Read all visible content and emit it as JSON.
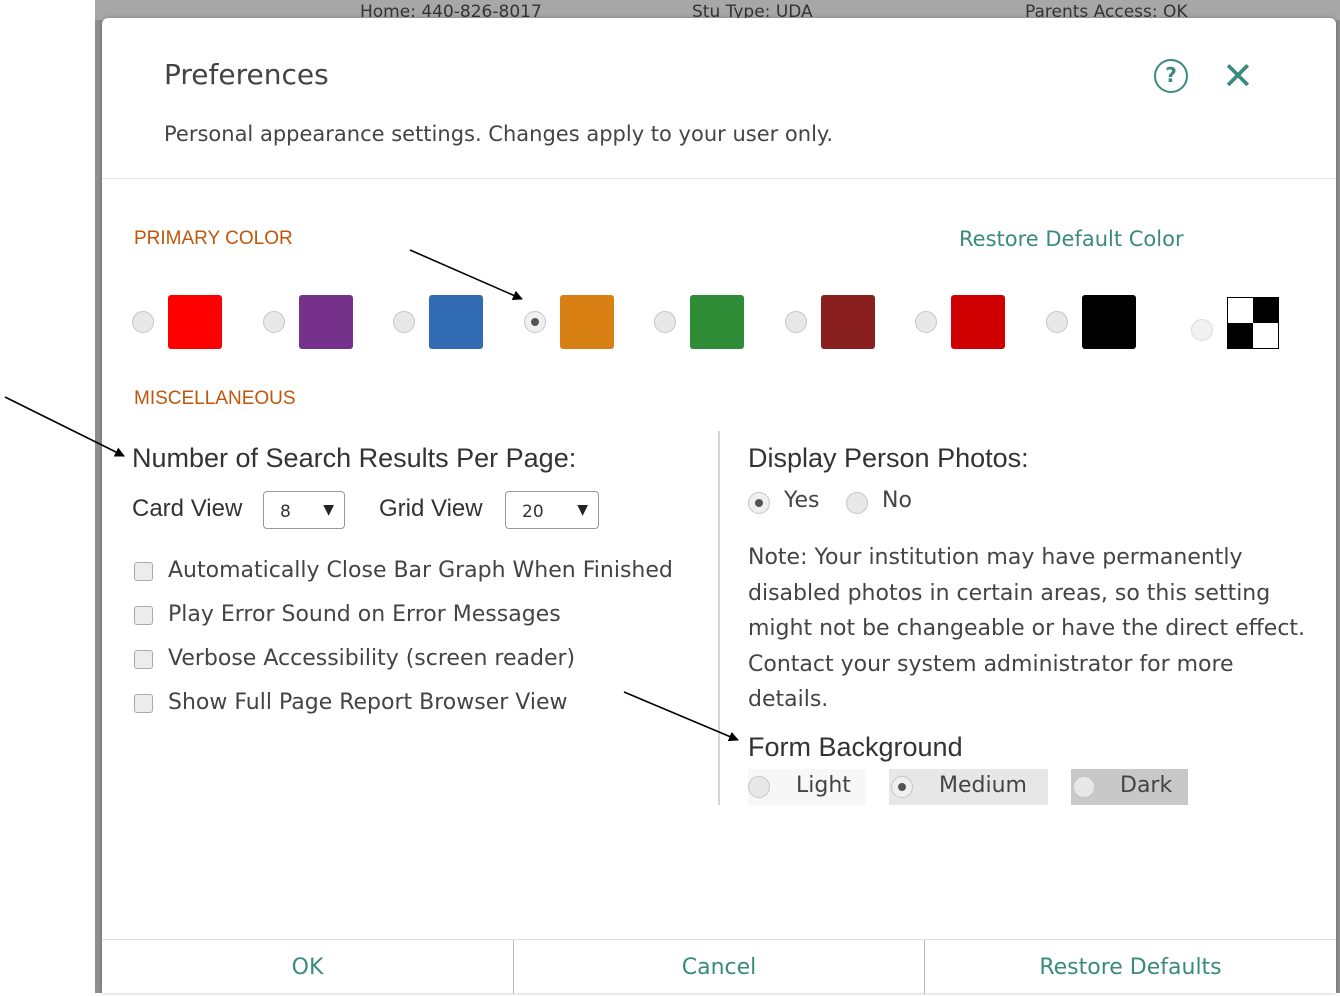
{
  "background": {
    "header": [
      "Home: 440-826-8017",
      "Stu Type: UDA",
      "Parents Access: OK"
    ]
  },
  "dialog": {
    "title": "Preferences",
    "subtitle": "Personal appearance settings. Changes apply to your user only.",
    "help_icon": "question-circle-icon",
    "close_icon": "close-x-icon",
    "help_glyph": "?",
    "close_glyph": "✕"
  },
  "primary_color": {
    "section_label": "PRIMARY COLOR",
    "restore_label": "Restore Default Color",
    "swatches": [
      {
        "color": "#ff0000",
        "selected": false
      },
      {
        "color": "#76318a",
        "selected": false
      },
      {
        "color": "#316cb3",
        "selected": false
      },
      {
        "color": "#d88013",
        "selected": true
      },
      {
        "color": "#2e8b36",
        "selected": false
      },
      {
        "color": "#8a1f1f",
        "selected": false
      },
      {
        "color": "#d10000",
        "selected": false
      },
      {
        "color": "#000000",
        "selected": false
      },
      {
        "color": "checkerboard",
        "selected": false
      }
    ]
  },
  "misc": {
    "section_label": "MISCELLANEOUS",
    "results_heading": "Number of Search Results Per Page:",
    "card_view_label": "Card View",
    "card_view_value": "8",
    "grid_view_label": "Grid View",
    "grid_view_value": "20",
    "checkboxes": [
      {
        "label": "Automatically Close Bar Graph When Finished",
        "checked": false
      },
      {
        "label": "Play Error Sound on Error Messages",
        "checked": false
      },
      {
        "label": "Verbose Accessibility (screen reader)",
        "checked": false
      },
      {
        "label": "Show Full Page Report Browser View",
        "checked": false
      }
    ],
    "photos_heading": "Display Person Photos:",
    "photos_yes": "Yes",
    "photos_no": "No",
    "photos_selected": "Yes",
    "note": "Note: Your institution may have permanently disabled photos in certain areas, so this setting might not be changeable or have the direct effect. Contact your system administrator for more details.",
    "form_bg_heading": "Form Background",
    "form_bg_options": [
      "Light",
      "Medium",
      "Dark"
    ],
    "form_bg_selected": "Medium"
  },
  "footer": {
    "ok": "OK",
    "cancel": "Cancel",
    "restore_defaults": "Restore Defaults"
  },
  "colors": {
    "accent": "#3a8a7e",
    "section": "#c0560a"
  }
}
